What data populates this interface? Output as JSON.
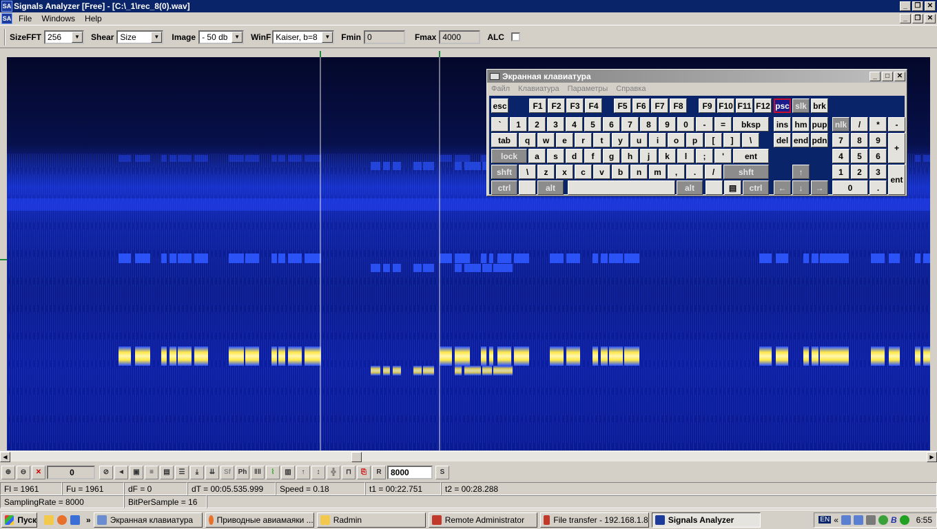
{
  "app": {
    "title": "Signals Analyzer [Free] - [C:\\_1\\rec_8(0).wav]",
    "logo": "SA"
  },
  "menu": [
    "File",
    "Windows",
    "Help"
  ],
  "toolbar": {
    "sizefft_label": "SizeFFT",
    "sizefft_value": "256",
    "shear_label": "Shear",
    "shear_value": "Size",
    "image_label": "Image",
    "image_value": "- 50 db",
    "winf_label": "WinF",
    "winf_value": "Kaiser, b=8",
    "fmin_label": "Fmin",
    "fmin_value": "0",
    "fmax_label": "Fmax",
    "fmax_value": "4000",
    "alc_label": "ALC"
  },
  "bottom_toolbar": {
    "counter_value": "0",
    "ph_label": "Ph",
    "r_label": "R",
    "rate_value": "8000",
    "s_label": "S"
  },
  "status": {
    "fl": "Fl = 1961",
    "fu": "Fu = 1961",
    "df": "dF = 0",
    "dt": "dT = 00:05.535.999",
    "speed": "Speed = 0.18",
    "t1": "t1 = 00:22.751",
    "t2": "t2 = 00:28.288",
    "sampling_rate": "SamplingRate = 8000",
    "bits": "BitPerSample = 16"
  },
  "osk": {
    "title": "Экранная клавиатура",
    "menu": [
      "Файл",
      "Клавиатура",
      "Параметры",
      "Справка"
    ],
    "rows": {
      "fkeys": [
        "esc",
        "F1",
        "F2",
        "F3",
        "F4",
        "F5",
        "F6",
        "F7",
        "F8",
        "F9",
        "F10",
        "F11",
        "F12",
        "psc",
        "slk",
        "brk"
      ],
      "num": [
        "`",
        "1",
        "2",
        "3",
        "4",
        "5",
        "6",
        "7",
        "8",
        "9",
        "0",
        "-",
        "=",
        "bksp",
        "ins",
        "hm",
        "pup",
        "nlk",
        "/",
        "*",
        "-"
      ],
      "top": [
        "tab",
        "q",
        "w",
        "e",
        "r",
        "t",
        "y",
        "u",
        "i",
        "o",
        "p",
        "[",
        "]",
        "\\",
        "del",
        "end",
        "pdn",
        "7",
        "8",
        "9",
        "+"
      ],
      "home": [
        "lock",
        "a",
        "s",
        "d",
        "f",
        "g",
        "h",
        "j",
        "k",
        "l",
        ";",
        "'",
        "ent",
        "4",
        "5",
        "6"
      ],
      "bottom": [
        "shft",
        "\\",
        "z",
        "x",
        "c",
        "v",
        "b",
        "n",
        "m",
        ",",
        ".",
        "/",
        "shft",
        "↑",
        "1",
        "2",
        "3",
        "ent"
      ],
      "space": [
        "ctrl",
        "alt",
        "alt",
        "ctrl",
        "←",
        "↓",
        "→",
        "0",
        "."
      ]
    }
  },
  "taskbar": {
    "start": "Пуск",
    "items": [
      "Экранная клавиатура",
      "Приводные авиамаяки ...",
      "Radmin",
      "Remote Administrator",
      "File transfer - 192.168.1.8",
      "Signals Analyzer"
    ],
    "lang": "EN",
    "clock": "6:55"
  },
  "colors": {
    "title_active": "#0a246a",
    "spectrum_bg": "#050a28",
    "signal_hot": "#ffee33",
    "signal_mid": "#2850ff"
  }
}
